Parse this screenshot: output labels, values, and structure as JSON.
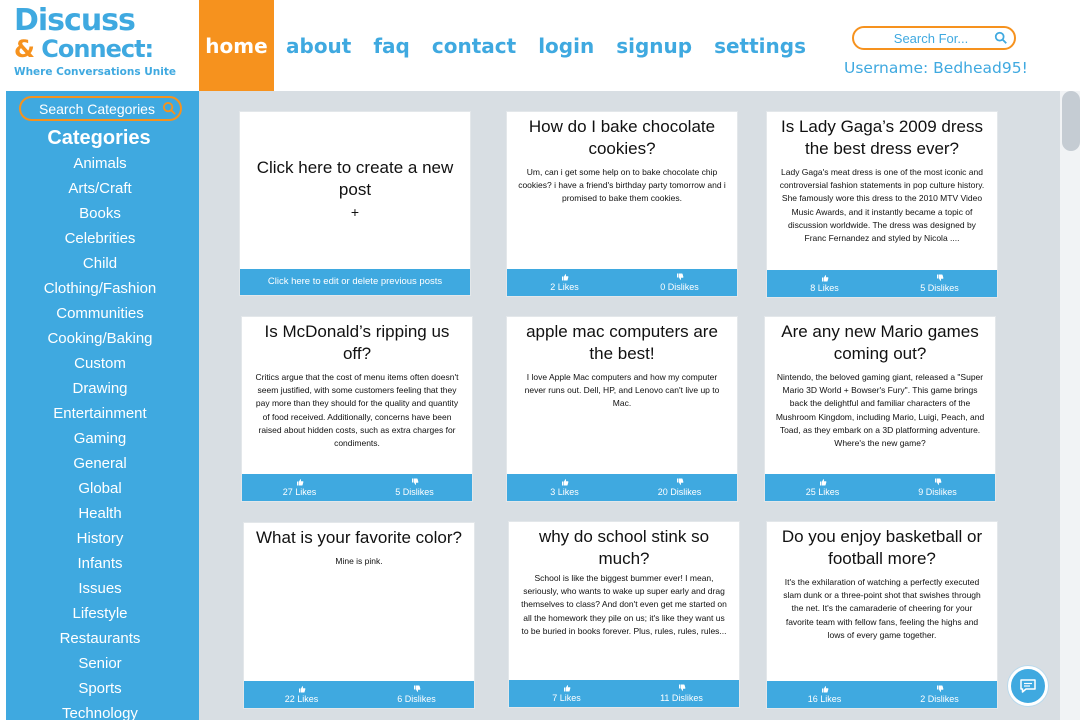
{
  "logo": {
    "line1": "Discuss",
    "amp": "&",
    "line2": "Connect:",
    "tagline": "Where Conversations Unite"
  },
  "nav": {
    "items": [
      "home",
      "about",
      "faq",
      "contact",
      "login",
      "signup",
      "settings"
    ],
    "active": "home"
  },
  "search": {
    "placeholder": "Search For..."
  },
  "user": {
    "label": "Username: Bedhead95!"
  },
  "sidebar": {
    "search_placeholder": "Search Categories",
    "title": "Categories",
    "items": [
      "Animals",
      "Arts/Craft",
      "Books",
      "Celebrities",
      "Child",
      "Clothing/Fashion",
      "Communities",
      "Cooking/Baking",
      "Custom",
      "Drawing",
      "Entertainment",
      "Gaming",
      "General",
      "Global",
      "Health",
      "History",
      "Infants",
      "Issues",
      "Lifestyle",
      "Restaurants",
      "Senior",
      "Sports",
      "Technology"
    ]
  },
  "create": {
    "text": "Click here to create a new post",
    "plus": "+",
    "edit_label": "Click here to edit or delete previous posts"
  },
  "posts": [
    {
      "title": "How do I bake chocolate cookies?",
      "body": "Um, can i get some help on to bake chocolate chip cookies? i have a friend's birthday party tomorrow and i promised to bake them cookies.",
      "likes": "2 Likes",
      "dislikes": "0 Dislikes"
    },
    {
      "title": "Is Lady Gaga’s 2009 dress the best dress ever?",
      "body": "Lady Gaga's meat dress is one of the most iconic and controversial fashion statements in pop culture history. She famously wore this dress to the 2010 MTV Video Music Awards, and it instantly became a topic of discussion worldwide. The dress was designed by Franc Fernandez and styled by Nicola ....",
      "likes": "8 Likes",
      "dislikes": "5 Dislikes"
    },
    {
      "title": "Is McDonald’s ripping us off?",
      "body": "Critics argue that the cost of menu items often doesn't seem justified, with some customers feeling that they pay more than they should for the quality and quantity of food received. Additionally, concerns have been raised about hidden costs, such as extra charges for condiments.",
      "likes": "27 Likes",
      "dislikes": "5 Dislikes"
    },
    {
      "title": "apple mac computers are the best!",
      "body": "I love Apple Mac computers and how my computer never runs out. Dell, HP, and Lenovo can't live up to Mac.",
      "likes": "3 Likes",
      "dislikes": "20 Dislikes"
    },
    {
      "title": "Are any new Mario games coming out?",
      "body": "Nintendo, the beloved gaming giant, released a \"Super Mario 3D World + Bowser's Fury\". This game brings back the delightful and familiar characters of the Mushroom Kingdom, including Mario, Luigi, Peach, and Toad, as they embark on a 3D platforming adventure. Where's the new game?",
      "likes": "25 Likes",
      "dislikes": "9 Dislikes"
    },
    {
      "title": "What is your favorite color?",
      "body": "Mine is pink.",
      "likes": "22 Likes",
      "dislikes": "6 Dislikes"
    },
    {
      "title": "why do school stink so much?",
      "body": "School is like the biggest bummer ever! I mean, seriously, who wants to wake up super early and drag themselves to class? And don't even get me started on all the homework they pile on us; it's like they want us to be buried in books forever. Plus, rules, rules, rules...",
      "likes": "7 Likes",
      "dislikes": "11 Dislikes"
    },
    {
      "title": "Do you enjoy basketball or football more?",
      "body": "It's the exhilaration of watching a perfectly executed slam dunk or a three-point shot that swishes through the net. It's the camaraderie of cheering for your favorite team with fellow fans, feeling the highs and lows of every game together.",
      "likes": "16 Likes",
      "dislikes": "2 Dislikes"
    }
  ],
  "colors": {
    "accent": "#3fa9e0",
    "orange": "#f6921e",
    "main_bg": "#d8dee3"
  },
  "icons": {
    "search": "search-icon",
    "like": "thumbs-up-icon",
    "dislike": "thumbs-down-icon",
    "chat": "chat-bubble-icon"
  }
}
